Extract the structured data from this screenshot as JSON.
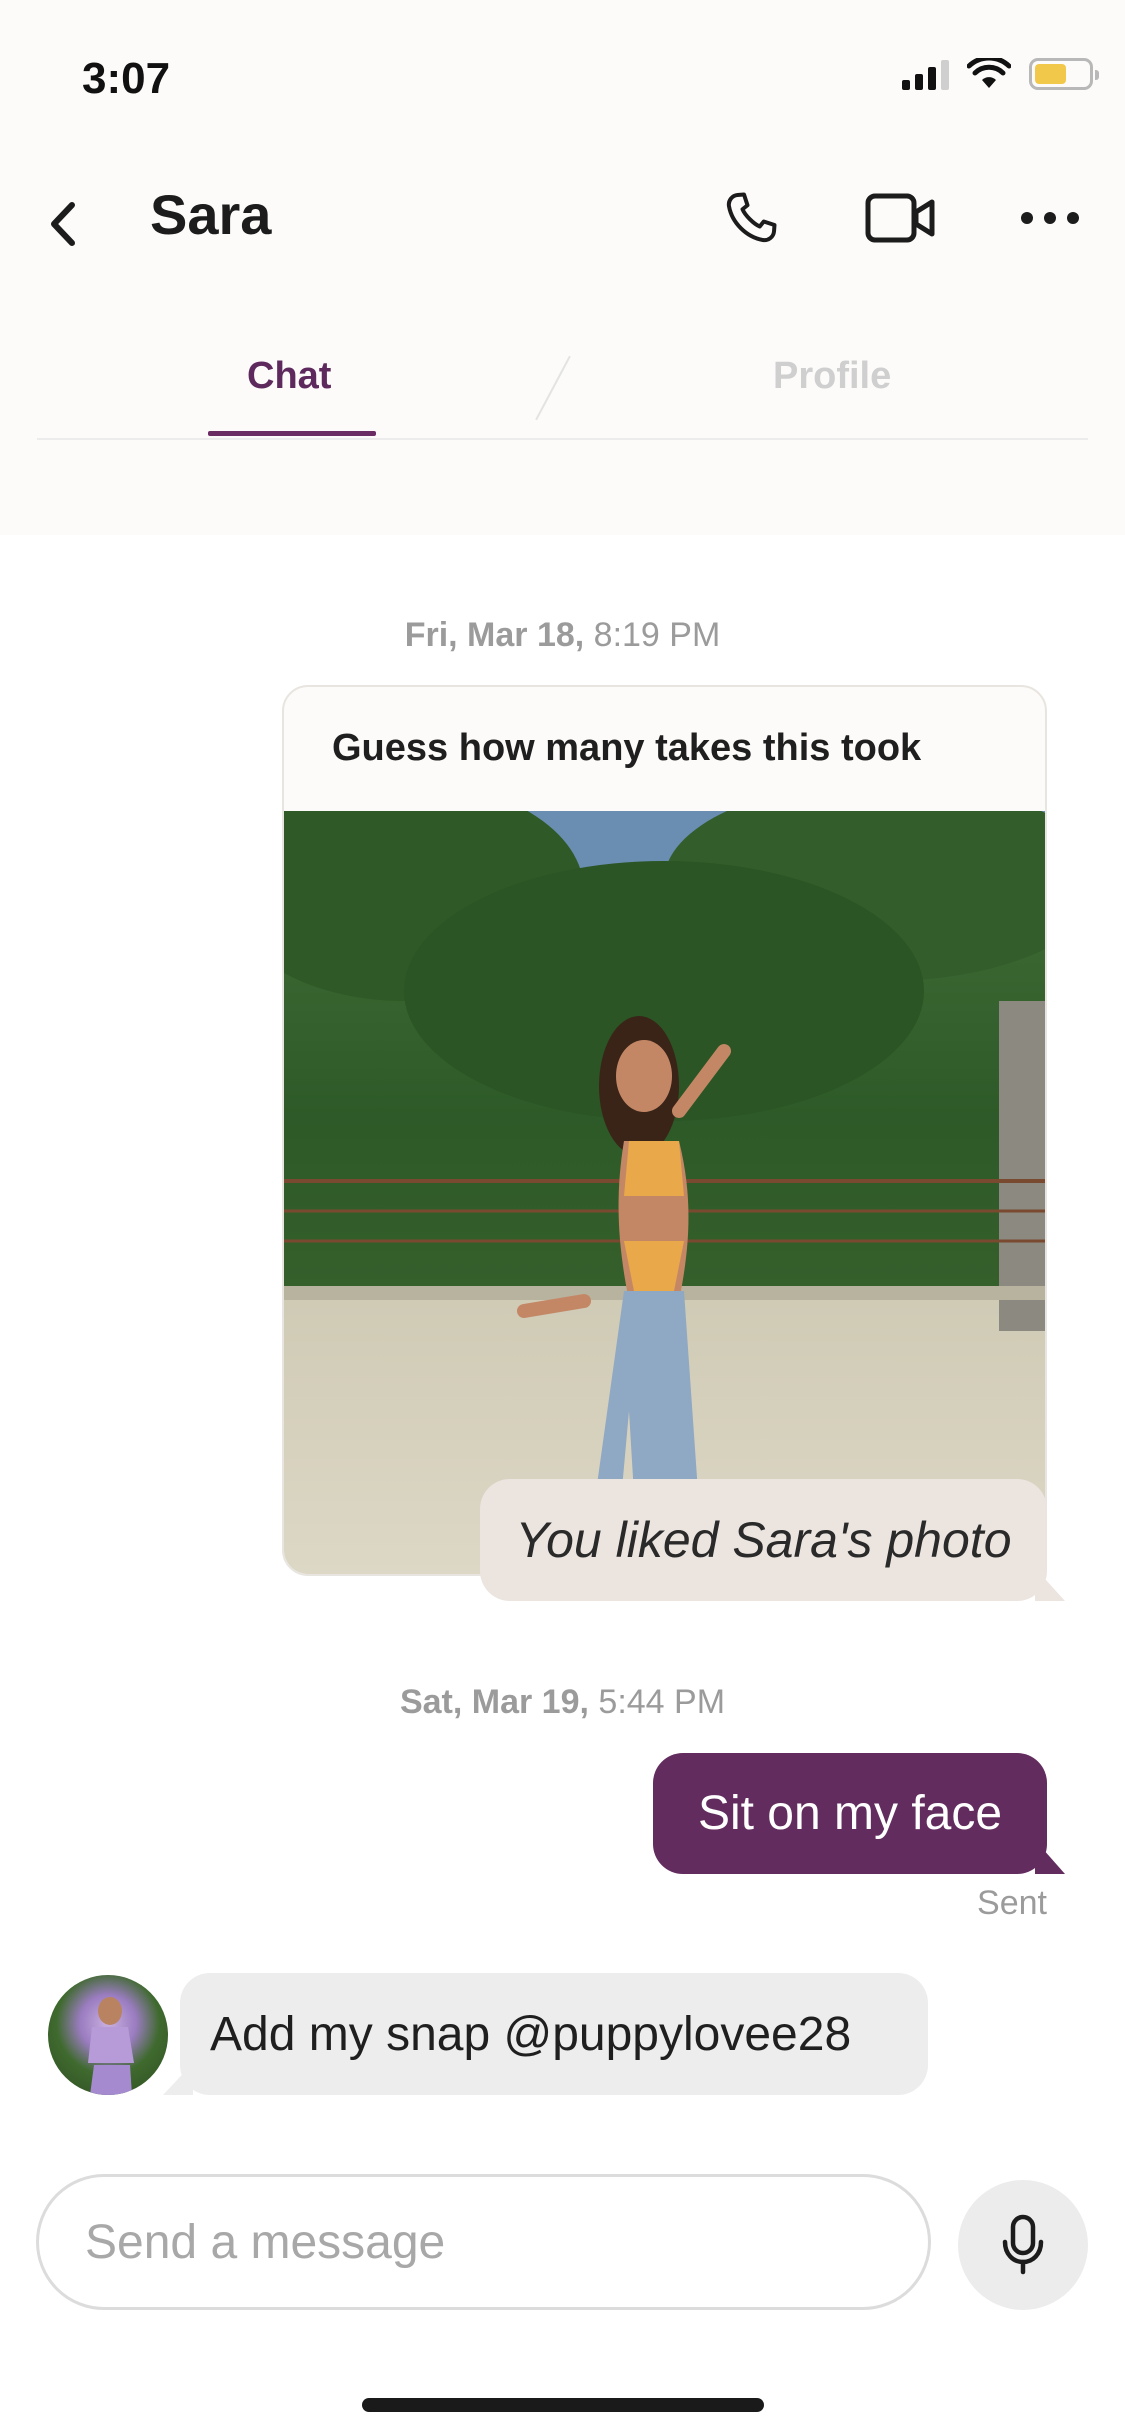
{
  "status_bar": {
    "time": "3:07",
    "battery_level": 0.6
  },
  "header": {
    "title": "Sara",
    "icons": [
      "chevron-left-icon",
      "phone-icon",
      "video-camera-icon",
      "more-horizontal-icon"
    ]
  },
  "tabs": [
    {
      "label": "Chat",
      "active": true
    },
    {
      "label": "Profile",
      "active": false
    }
  ],
  "messages": {
    "stamp1": {
      "date": "Fri, Mar 18,",
      "time": "8:19 PM"
    },
    "photo_caption": "Guess how many takes this took",
    "liked_text": "You liked Sara's photo",
    "stamp2": {
      "date": "Sat, Mar 19,",
      "time": "5:44 PM"
    },
    "sent_text": "Sit on my face",
    "sent_status": "Sent",
    "received_text": "Add my snap @puppylovee28"
  },
  "composer": {
    "placeholder": "Send a message"
  },
  "colors": {
    "accent": "#622c5e",
    "tab_active": "#5e2a5e",
    "liked_bubble": "#ece4df",
    "received_bubble": "#ededed"
  }
}
